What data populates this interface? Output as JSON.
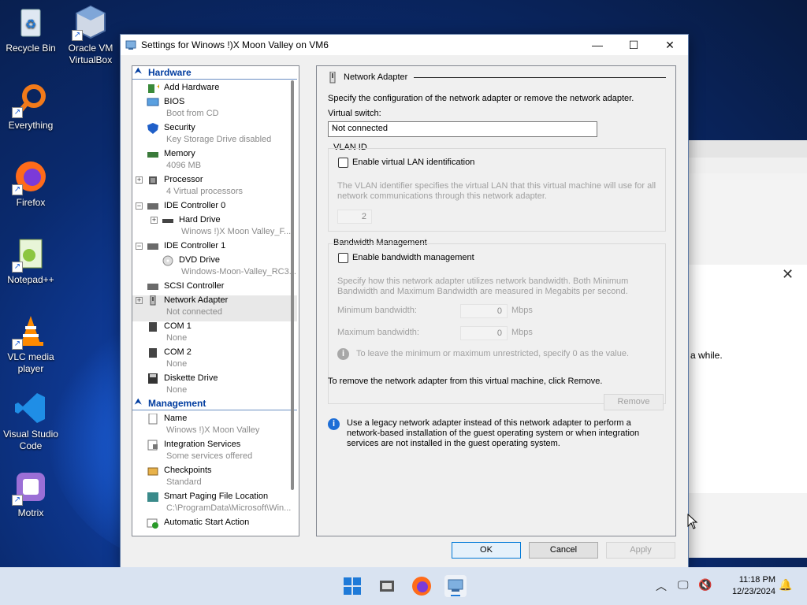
{
  "desktop": {
    "icons": [
      {
        "label": "Recycle Bin"
      },
      {
        "label": "Oracle VM VirtualBox"
      },
      {
        "label": "Everything"
      },
      {
        "label": "Firefox"
      },
      {
        "label": "Notepad++"
      },
      {
        "label": "VLC media player"
      },
      {
        "label": "Visual Studio Code"
      },
      {
        "label": "Motrix"
      }
    ]
  },
  "background_window": {
    "text": "a while."
  },
  "window": {
    "title": "Settings for Winows !)X Moon Valley on VM6",
    "buttons": {
      "minimize": "—",
      "maximize": "☐",
      "close": "✕"
    }
  },
  "tree": {
    "hardware_header": "Hardware",
    "management_header": "Management",
    "items": {
      "add_hardware": {
        "label": "Add Hardware"
      },
      "bios": {
        "label": "BIOS",
        "sub": "Boot from CD"
      },
      "security": {
        "label": "Security",
        "sub": "Key Storage Drive disabled"
      },
      "memory": {
        "label": "Memory",
        "sub": "4096 MB"
      },
      "processor": {
        "label": "Processor",
        "sub": "4 Virtual processors"
      },
      "ide0": {
        "label": "IDE Controller 0"
      },
      "hard_drive": {
        "label": "Hard Drive",
        "sub": "Winows !)X Moon Valley_F..."
      },
      "ide1": {
        "label": "IDE Controller 1"
      },
      "dvd_drive": {
        "label": "DVD Drive",
        "sub": "Windows-Moon-Valley_RC3..."
      },
      "scsi": {
        "label": "SCSI Controller"
      },
      "network_adapter": {
        "label": "Network Adapter",
        "sub": "Not connected"
      },
      "com1": {
        "label": "COM 1",
        "sub": "None"
      },
      "com2": {
        "label": "COM 2",
        "sub": "None"
      },
      "diskette": {
        "label": "Diskette Drive",
        "sub": "None"
      },
      "name": {
        "label": "Name",
        "sub": "Winows !)X Moon Valley"
      },
      "integration": {
        "label": "Integration Services",
        "sub": "Some services offered"
      },
      "checkpoints": {
        "label": "Checkpoints",
        "sub": "Standard"
      },
      "smart_paging": {
        "label": "Smart Paging File Location",
        "sub": "C:\\ProgramData\\Microsoft\\Win..."
      },
      "auto_start": {
        "label": "Automatic Start Action"
      }
    }
  },
  "main": {
    "heading": "Network Adapter",
    "description": "Specify the configuration of the network adapter or remove the network adapter.",
    "virtual_switch_label": "Virtual switch:",
    "virtual_switch_value": "Not connected",
    "vlan": {
      "title": "VLAN ID",
      "enable_label": "Enable virtual LAN identification",
      "enabled": false,
      "help": "The VLAN identifier specifies the virtual LAN that this virtual machine will use for all",
      "help2": "network communications through this network adapter.",
      "value": "2"
    },
    "bandwidth": {
      "title": "Bandwidth Management",
      "enable_label": "Enable bandwidth management",
      "enabled": false,
      "help": "Specify how this network adapter utilizes network bandwidth. Both Minimum",
      "help2": "Bandwidth and Maximum Bandwidth are measured in Megabits per second.",
      "min_label": "Minimum bandwidth:",
      "min_value": "0",
      "max_label": "Maximum bandwidth:",
      "max_value": "0",
      "unit": "Mbps",
      "note": "To leave the minimum or maximum unrestricted, specify 0 as the value."
    },
    "remove_text": "To remove the network adapter from this virtual machine, click Remove.",
    "remove_label": "Remove",
    "legacy_line1": "Use a legacy network adapter instead of this network adapter to perform a",
    "legacy_line2": "network-based installation of the guest operating system or when integration",
    "legacy_line3": "services are not installed in the guest operating system."
  },
  "footer": {
    "ok": "OK",
    "cancel": "Cancel",
    "apply": "Apply"
  },
  "taskbar": {
    "time": "11:18 PM",
    "date": "12/23/2024"
  }
}
